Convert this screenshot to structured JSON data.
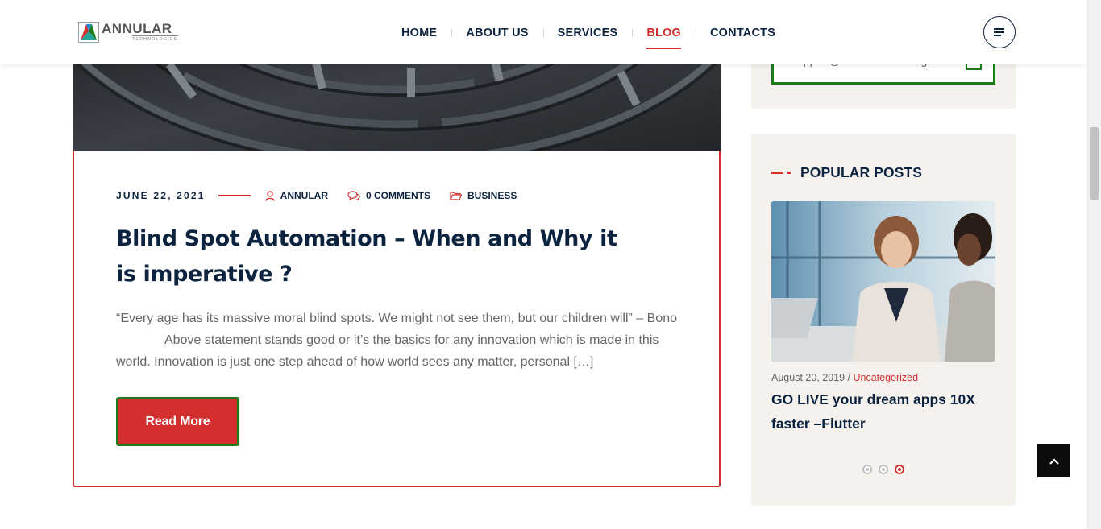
{
  "header": {
    "logo_text": "ANNULAR",
    "logo_subtext": "TECHNOLOGIES",
    "nav": [
      {
        "label": "HOME",
        "active": false
      },
      {
        "label": "ABOUT US",
        "active": false
      },
      {
        "label": "SERVICES",
        "active": false
      },
      {
        "label": "BLOG",
        "active": true
      },
      {
        "label": "CONTACTS",
        "active": false
      }
    ],
    "menu_icon": "hamburger-icon"
  },
  "post": {
    "date": "JUNE 22, 2021",
    "author": "ANNULAR",
    "comments": "0 COMMENTS",
    "category": "BUSINESS",
    "title": "Blind Spot Automation – When and Why it is imperative ?",
    "excerpt_line1": "“Every age has its massive moral blind spots. We might not see them, but our children will” – Bono",
    "excerpt_line2": "Above statement stands good or it’s the basics for any innovation which is made in this",
    "excerpt_line3": "world. Innovation is just one step ahead of how world sees any matter, personal […]",
    "read_more_label": "Read More",
    "icons": {
      "author": "user-icon",
      "comments": "comments-icon",
      "category": "folder-icon"
    }
  },
  "sidebar": {
    "email_value": "support@annulartechnologies.com",
    "popular": {
      "heading": "POPULAR POSTS",
      "date": "August 20, 2019",
      "separator": " / ",
      "category": "Uncategorized",
      "title": "GO LIVE your dream apps 10X faster –Flutter",
      "slides": 3,
      "active_slide": 3
    }
  },
  "colors": {
    "accent": "#d32f2f",
    "navy": "#0c2340",
    "green_border": "#1a7d1a",
    "sidebar_bg": "#f5f2ee"
  }
}
